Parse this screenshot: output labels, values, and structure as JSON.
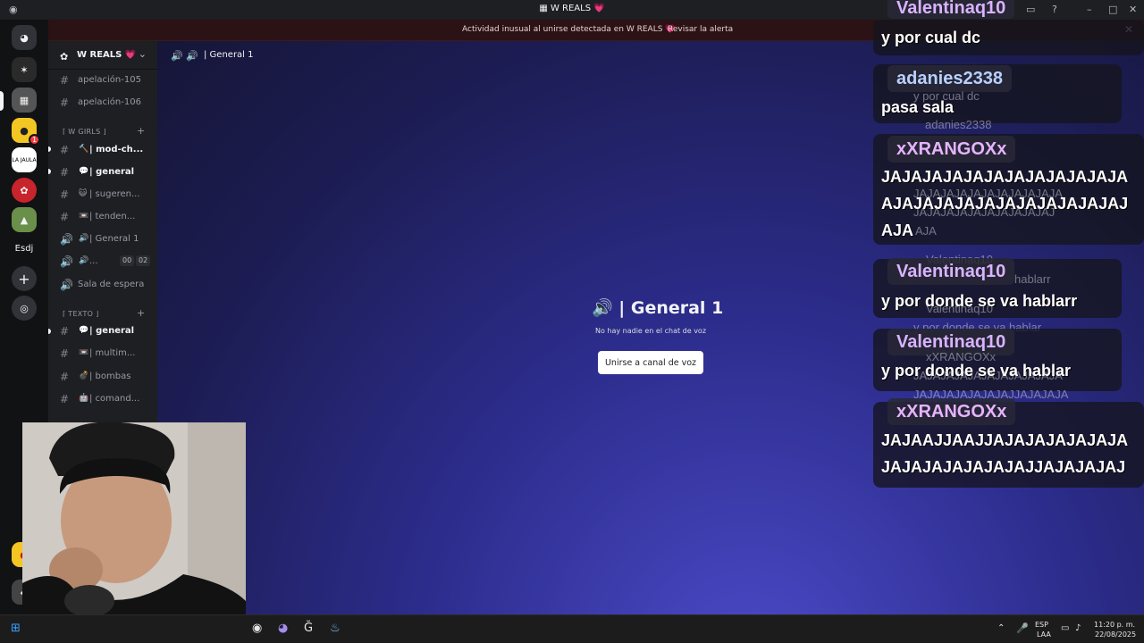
{
  "window": {
    "title": "W REALS",
    "title_icon": "server-icon",
    "heart": "💗"
  },
  "alert": {
    "message": "Actividad inusual al unirse detectada en W REALS 💗",
    "action": "Revisar la alerta"
  },
  "rail": {
    "text_server": "Esdj",
    "unread_badge": "1"
  },
  "server": {
    "name": "W REALS 💗"
  },
  "channels": {
    "top": [
      {
        "label": "apelación-105"
      },
      {
        "label": "apelación-106"
      }
    ],
    "category_girls": "⌈ W GIRLS ⌋",
    "girls": [
      {
        "emoji": "🔨",
        "label": "| mod-ch..."
      },
      {
        "emoji": "💬",
        "label": "| general"
      },
      {
        "emoji": "😺",
        "label": "| sugeren..."
      },
      {
        "emoji": "📼",
        "label": "| tenden..."
      },
      {
        "emoji": "🔊",
        "label": "| General 1"
      },
      {
        "emoji": "🔊",
        "label": "...",
        "count_a": "00",
        "count_b": "02"
      },
      {
        "emoji": "",
        "label": "Sala de espera"
      }
    ],
    "category_texto": "⌈ TEXTO ⌋",
    "texto": [
      {
        "emoji": "💬",
        "label": "| general"
      },
      {
        "emoji": "📼",
        "label": "| multim..."
      },
      {
        "emoji": "💣",
        "label": "| bombas"
      },
      {
        "emoji": "🤖",
        "label": "| comand..."
      }
    ]
  },
  "main": {
    "header_title": "| General 1",
    "voice_title": "| General 1",
    "voice_subtitle": "No hay nadie en el chat de voz",
    "join_button": "Unirse a canal de voz"
  },
  "chat": [
    {
      "user": "Valentinaq10",
      "text": "y por cual dc",
      "color": "#d9b3ff"
    },
    {
      "user": "adanies2338",
      "text": "pasa sala",
      "color": "#b8d0ff"
    },
    {
      "user": "xXRANGOXx",
      "text_lines": [
        "JAJAJAJAJAJAJAJAJAJAJAJA",
        "AJAJAJAJAJAJAJAJAJAJAJAJ",
        "AJA"
      ],
      "color": "#e7b3ff"
    },
    {
      "user": "Valentinaq10",
      "text": "y por donde se va hablarr",
      "color": "#d9b3ff"
    },
    {
      "user": "Valentinaq10",
      "text": "y por donde se va hablar",
      "color": "#d9b3ff"
    },
    {
      "user": "xXRANGOXx",
      "text_lines": [
        "JAJAAJJAAJJAJAJAJAJAJAJA",
        "JAJAJAJAJAJAJAJJAJAJAJAJ"
      ],
      "color": "#e7b3ff"
    }
  ],
  "chat_ghost": [
    "y por cual dc",
    "adanies2338",
    "JAJAJAJAJAJAJAJAJAJAJA",
    "JAJAJAJAJAJAJAJAJAJAJ",
    "AJA",
    "Valentinaq10",
    "hablarr",
    "Valentinaq10",
    "y por donde se va hablar",
    "xXRANGOXx",
    "JAJAJAJAJAJAJAJAJAJAJA",
    "JAJAJAJAJAJAJAJJAJAJAJA"
  ],
  "taskbar": {
    "lang_top": "ESP",
    "lang_bottom": "LAA",
    "time": "11:20 p. m.",
    "date": "22/08/2025"
  },
  "colors": {
    "accent": "#5865f2",
    "alert_bg": "#2b1214"
  }
}
